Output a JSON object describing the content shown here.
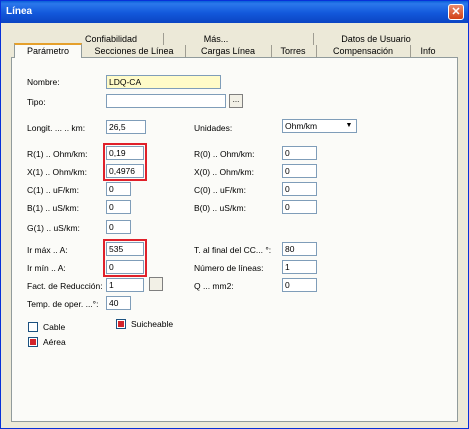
{
  "window": {
    "title": "Línea",
    "close_glyph": "✕"
  },
  "tabs_row1": [
    "Confiabilidad",
    "Más...",
    "Datos de Usuario"
  ],
  "tabs_row2": [
    "Parámetro",
    "Secciones de Línea",
    "Cargas Línea",
    "Torres",
    "Compensación",
    "Info"
  ],
  "active_tab": "Parámetro",
  "form": {
    "nombre_label": "Nombre:",
    "nombre_value": "LDQ-CA",
    "tipo_label": "Tipo:",
    "tipo_value": "",
    "tipo_browse": "...",
    "longit_label": "Longit. ... .. km:",
    "longit_value": "26,5",
    "unidades_label": "Unidades:",
    "unidades_value": "Ohm/km",
    "r1_label": "R(1) .. Ohm/km:",
    "r1_value": "0,19",
    "r0_label": "R(0) .. Ohm/km:",
    "r0_value": "0",
    "x1_label": "X(1) .. Ohm/km:",
    "x1_value": "0,4976",
    "x0_label": "X(0) .. Ohm/km:",
    "x0_value": "0",
    "c1_label": "C(1) .. uF/km:",
    "c1_value": "0",
    "c0_label": "C(0) .. uF/km:",
    "c0_value": "0",
    "b1_label": "B(1) .. uS/km:",
    "b1_value": "0",
    "b0_label": "B(0) .. uS/km:",
    "b0_value": "0",
    "g1_label": "G(1) .. uS/km:",
    "g1_value": "0",
    "irmax_label": "Ir máx .. A:",
    "irmax_value": "535",
    "irmin_label": "Ir mín .. A:",
    "irmin_value": "0",
    "tfinal_label": "T. al final del CC... °:",
    "tfinal_value": "80",
    "nlineas_label": "Número de líneas:",
    "nlineas_value": "1",
    "fact_label": "Fact. de Reducción:",
    "fact_value": "1",
    "q_label": "Q ... mm2:",
    "q_value": "0",
    "temp_label": "Temp. de oper. ...°:",
    "temp_value": "40"
  },
  "checkboxes": {
    "cable": {
      "label": "Cable",
      "checked": false
    },
    "suicheable": {
      "label": "Suicheable",
      "checked": true
    },
    "aerea": {
      "label": "Aérea",
      "checked": true
    }
  },
  "colors": {
    "titlebar": "#0a5fd8",
    "highlight_box": "#e0202a",
    "check": "#d2232a"
  },
  "icons": {
    "close": "close-icon",
    "dropdown": "chevron-down-icon"
  }
}
